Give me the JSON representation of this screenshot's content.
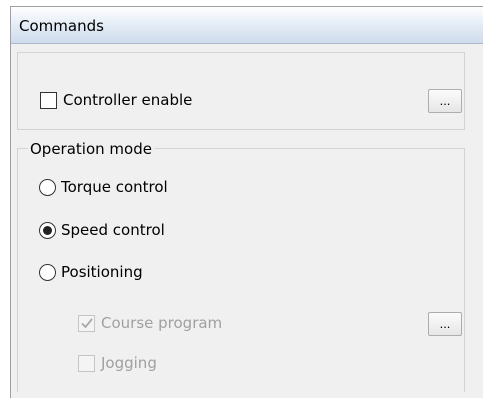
{
  "panel": {
    "title": "Commands"
  },
  "controller": {
    "enable_label": "Controller enable",
    "enable_checked": false,
    "more_button_label": "..."
  },
  "operation_mode": {
    "group_label": "Operation mode",
    "options": [
      {
        "label": "Torque control",
        "selected": false
      },
      {
        "label": "Speed control",
        "selected": true
      },
      {
        "label": "Positioning",
        "selected": false
      }
    ],
    "positioning": {
      "course_program_label": "Course program",
      "course_program_checked": true,
      "course_program_enabled": false,
      "course_more_button_label": "...",
      "jogging_label": "Jogging",
      "jogging_checked": false,
      "jogging_enabled": false
    }
  },
  "icons": {
    "checkbox_check": "check-icon",
    "radio_selected": "radio-dot-icon"
  },
  "colors": {
    "header_gradient_top": "#ffffff",
    "header_gradient_bottom": "#cfdcec",
    "panel_background": "#f0f0f0",
    "disabled_text": "#a0a0a0"
  }
}
